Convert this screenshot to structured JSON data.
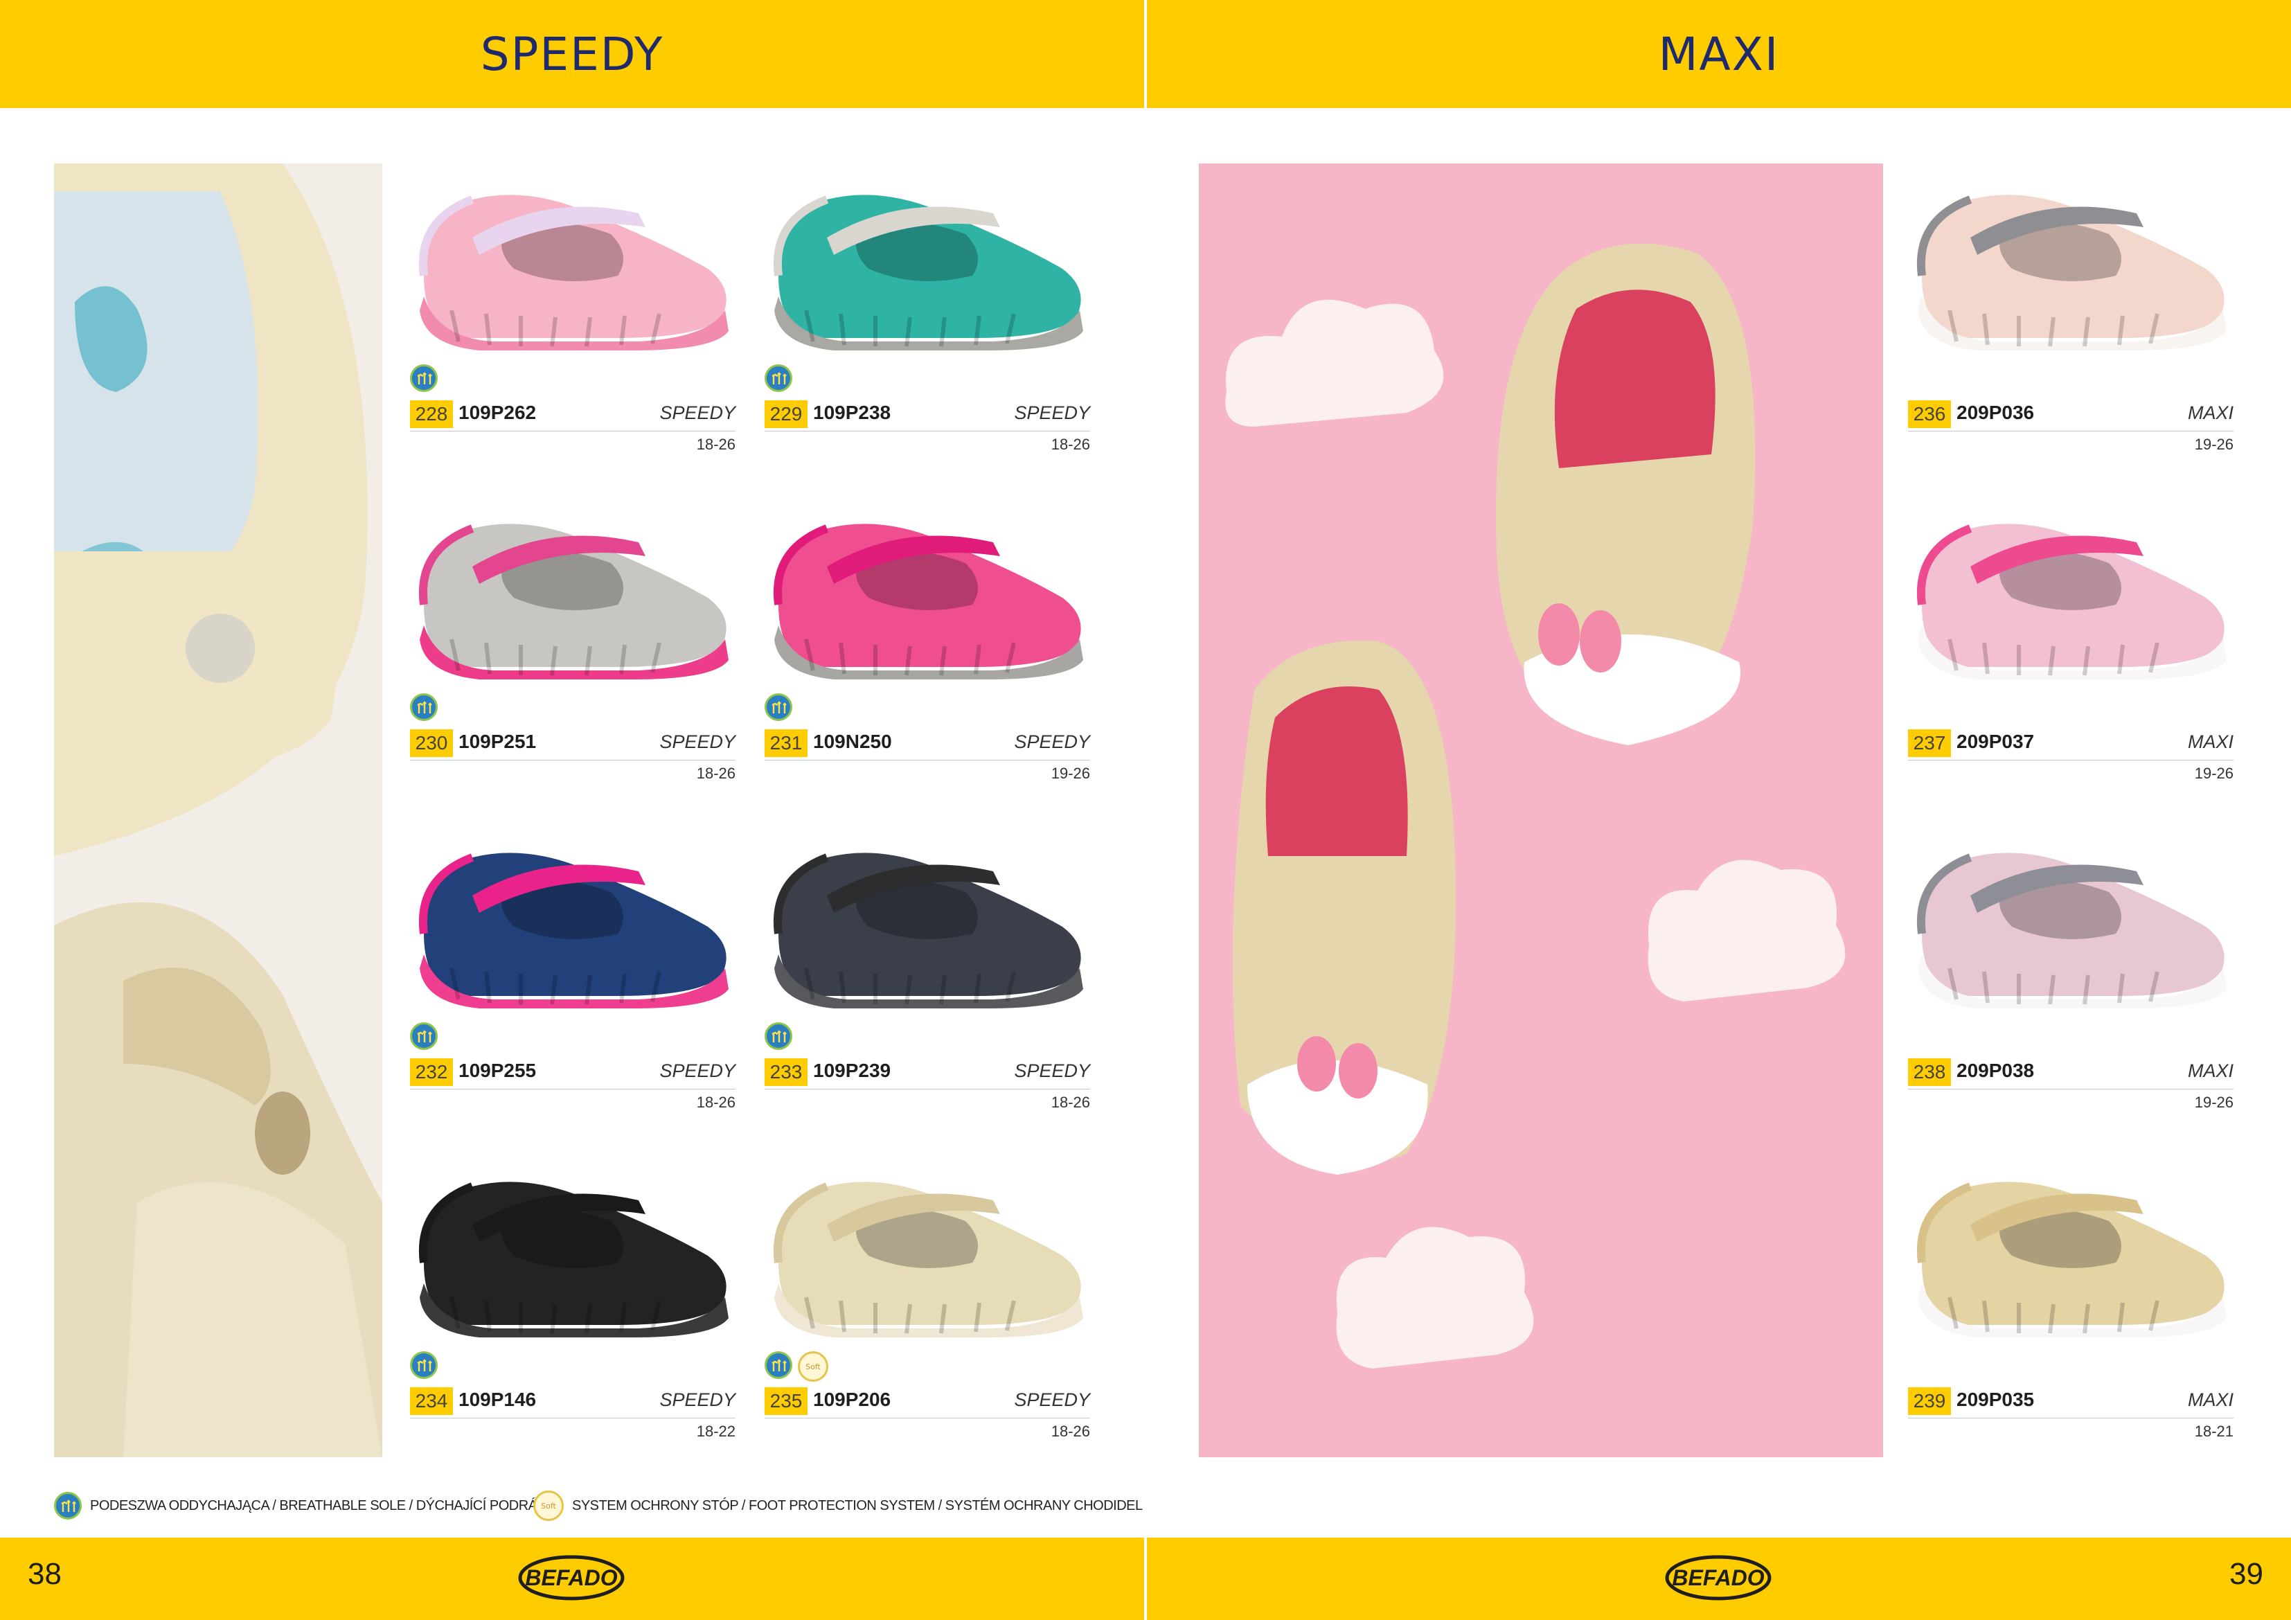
{
  "left_page": {
    "title": "SPEEDY",
    "page_number": "38",
    "brand": "BEFADO"
  },
  "right_page": {
    "title": "MAXI",
    "page_number": "39",
    "brand": "BEFADO"
  },
  "products_speedy": [
    {
      "num": "228",
      "code": "109P262",
      "line": "SPEEDY",
      "sizes": "18-26",
      "colors": [
        "#f7b4c6",
        "#f28bb0",
        "#e9d4ef"
      ]
    },
    {
      "num": "229",
      "code": "109P238",
      "line": "SPEEDY",
      "sizes": "18-26",
      "colors": [
        "#2eb3a4",
        "#a9a8a2",
        "#d9d6cf"
      ]
    },
    {
      "num": "230",
      "code": "109P251",
      "line": "SPEEDY",
      "sizes": "18-26",
      "colors": [
        "#c8c6c2",
        "#ed3d8a",
        "#e4458f"
      ]
    },
    {
      "num": "231",
      "code": "109N250",
      "line": "SPEEDY",
      "sizes": "19-26",
      "colors": [
        "#ef4e8f",
        "#a8a6a2",
        "#e01b7a"
      ]
    },
    {
      "num": "232",
      "code": "109P255",
      "line": "SPEEDY",
      "sizes": "18-26",
      "colors": [
        "#22407a",
        "#ef3e8f",
        "#e9238a"
      ]
    },
    {
      "num": "233",
      "code": "109P239",
      "line": "SPEEDY",
      "sizes": "18-26",
      "colors": [
        "#3a3f4a",
        "#58595c",
        "#2d2d2f"
      ]
    },
    {
      "num": "234",
      "code": "109P146",
      "line": "SPEEDY",
      "sizes": "18-22",
      "colors": [
        "#232323",
        "#3a3a3a",
        "#1a1a1a"
      ]
    },
    {
      "num": "235",
      "code": "109P206",
      "line": "SPEEDY",
      "sizes": "18-26",
      "colors": [
        "#e7dcb8",
        "#efe7d4",
        "#d7c99d"
      ]
    }
  ],
  "products_maxi": [
    {
      "num": "236",
      "code": "209P036",
      "line": "MAXI",
      "sizes": "19-26",
      "colors": [
        "#f3d7cc",
        "#f7f4f1",
        "#8f8f93"
      ]
    },
    {
      "num": "237",
      "code": "209P037",
      "line": "MAXI",
      "sizes": "19-26",
      "colors": [
        "#f3bfd3",
        "#f8f6f6",
        "#ee4a8f"
      ]
    },
    {
      "num": "238",
      "code": "209P038",
      "line": "MAXI",
      "sizes": "19-26",
      "colors": [
        "#e7c7d2",
        "#f8f6f6",
        "#8e8e96"
      ]
    },
    {
      "num": "239",
      "code": "209P035",
      "line": "MAXI",
      "sizes": "18-21",
      "colors": [
        "#e4d3a3",
        "#f8f6f6",
        "#d9c28a"
      ]
    }
  ],
  "legend": {
    "breathable": "PODESZWA ODDYCHAJĄCA  /  BREATHABLE SOLE  /  DÝCHAJÍCÍ PODRÁŽKA",
    "foot_protection": "SYSTEM OCHRONY STÓP  /  FOOT PROTECTION SYSTEM  /  SYSTÉM OCHRANY CHODIDEL",
    "soft_icon_label": "Soft"
  },
  "colors": {
    "accent": "#ffcc00",
    "title": "#1f2a6e"
  }
}
